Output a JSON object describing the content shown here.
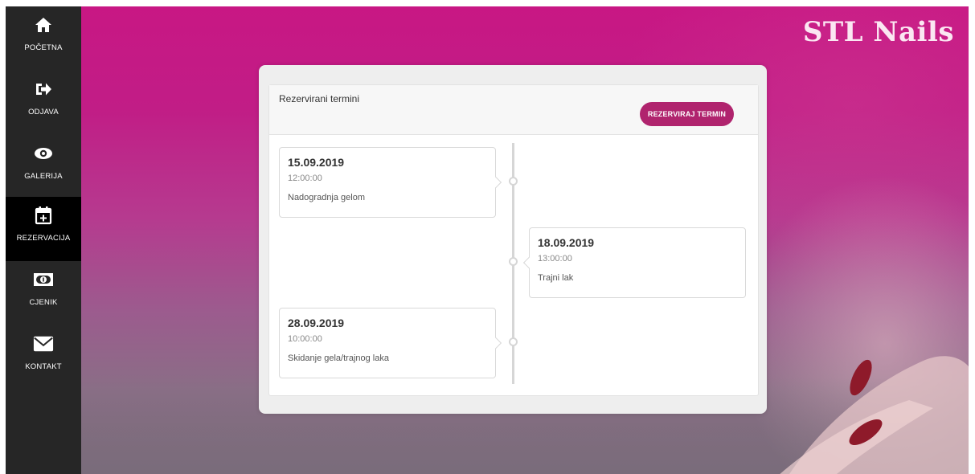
{
  "sidebar": {
    "items": [
      {
        "label": "POČETNA",
        "icon": "home-icon"
      },
      {
        "label": "ODJAVA",
        "icon": "sign-out-icon"
      },
      {
        "label": "GALERIJA",
        "icon": "eye-icon"
      },
      {
        "label": "REZERVACIJA",
        "icon": "calendar-plus-icon",
        "active": true
      },
      {
        "label": "CJENIK",
        "icon": "money-icon"
      },
      {
        "label": "KONTAKT",
        "icon": "envelope-icon"
      }
    ]
  },
  "brand": {
    "name": "STL Nails"
  },
  "reservations": {
    "title": "Rezervirani termini",
    "reserve_button": "REZERVIRAJ TERMIN",
    "entries": [
      {
        "date": "15.09.2019",
        "time": "12:00:00",
        "service": "Nadogradnja gelom"
      },
      {
        "date": "18.09.2019",
        "time": "13:00:00",
        "service": "Trajni lak"
      },
      {
        "date": "28.09.2019",
        "time": "10:00:00",
        "service": "Skidanje gela/trajnog laka"
      }
    ]
  },
  "colors": {
    "sidebar_bg": "#262626",
    "sidebar_active": "#000000",
    "accent": "#b0246e",
    "background_magenta": "#c81784"
  }
}
